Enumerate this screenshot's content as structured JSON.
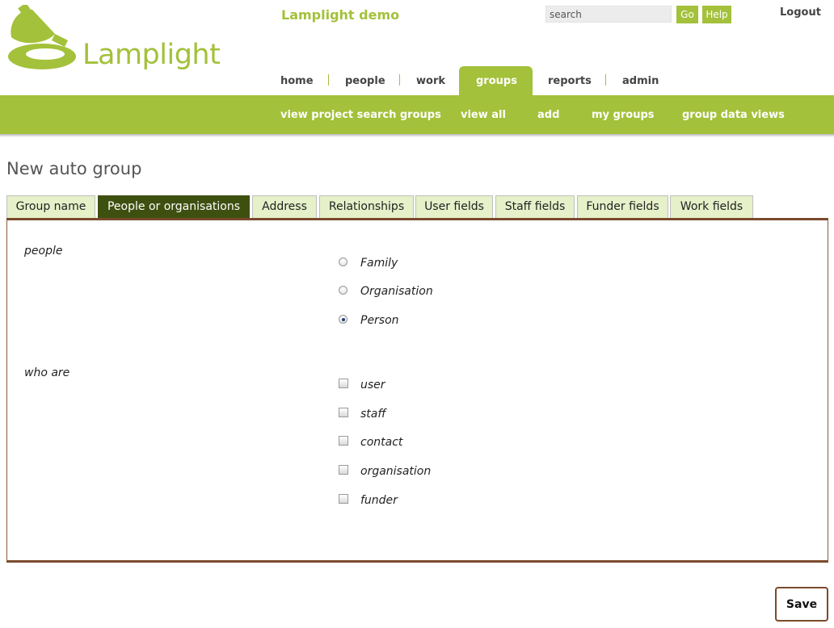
{
  "header": {
    "site_title": "Lamplight demo",
    "logo_text": "Lamplight",
    "search_placeholder": "search",
    "go_label": "Go",
    "help_label": "Help",
    "logout_label": "Logout"
  },
  "nav": {
    "items": [
      {
        "label": "home"
      },
      {
        "label": "people"
      },
      {
        "label": "work"
      },
      {
        "label": "groups",
        "active": true
      },
      {
        "label": "reports"
      },
      {
        "label": "admin"
      }
    ]
  },
  "subnav": {
    "items": [
      {
        "label": "view project search groups"
      },
      {
        "label": "view all"
      },
      {
        "label": "add"
      },
      {
        "label": "my groups"
      },
      {
        "label": "group data views"
      }
    ]
  },
  "page": {
    "title": "New auto group"
  },
  "tabs": [
    {
      "label": "Group name"
    },
    {
      "label": "People or organisations",
      "active": true
    },
    {
      "label": "Address"
    },
    {
      "label": "Relationships"
    },
    {
      "label": "User fields"
    },
    {
      "label": "Staff fields"
    },
    {
      "label": "Funder fields"
    },
    {
      "label": "Work fields"
    }
  ],
  "form": {
    "people_label": "people",
    "people_options": [
      {
        "label": "Family",
        "selected": false
      },
      {
        "label": "Organisation",
        "selected": false
      },
      {
        "label": "Person",
        "selected": true
      }
    ],
    "who_are_label": "who are",
    "who_are_options": [
      {
        "label": "user",
        "checked": false
      },
      {
        "label": "staff",
        "checked": false
      },
      {
        "label": "contact",
        "checked": false
      },
      {
        "label": "organisation",
        "checked": false
      },
      {
        "label": "funder",
        "checked": false
      }
    ]
  },
  "actions": {
    "save_label": "Save"
  },
  "colors": {
    "brand_green": "#a3c13a",
    "active_tab": "#3e5010",
    "tab_bg": "#e6f0c9",
    "panel_border": "#7a4a2c"
  },
  "icons": {
    "logo": "lamp-logo-icon"
  }
}
